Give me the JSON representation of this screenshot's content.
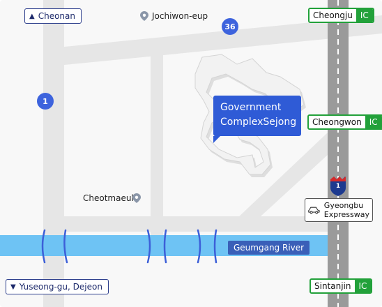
{
  "directions": {
    "north": {
      "arrow": "▲",
      "label": "Cheonan"
    },
    "south": {
      "arrow": "▼",
      "label": "Yuseong-gu, Dejeon"
    }
  },
  "places": {
    "jochiwon": "Jochiwon-eup",
    "cheotmaeul": "Cheotmaeul"
  },
  "routes": {
    "route_36": "36",
    "route_1": "1",
    "highway_shield": "1"
  },
  "callout": {
    "line1": "Government",
    "line2": "ComplexSejong"
  },
  "interchanges": [
    {
      "name": "Cheongju",
      "tag": "IC"
    },
    {
      "name": "Cheongwon",
      "tag": "IC"
    },
    {
      "name": "Sintanjin",
      "tag": "IC"
    }
  ],
  "river": {
    "label": "Geumgang River"
  },
  "expressway": {
    "line1": "Gyeongbu",
    "line2": "Expressway",
    "icon": "car-icon"
  },
  "colors": {
    "river": "#6ec3f4",
    "accent_blue": "#2f5bd6",
    "ic_green": "#22a13a",
    "highway_gray": "#9a9a9a"
  }
}
